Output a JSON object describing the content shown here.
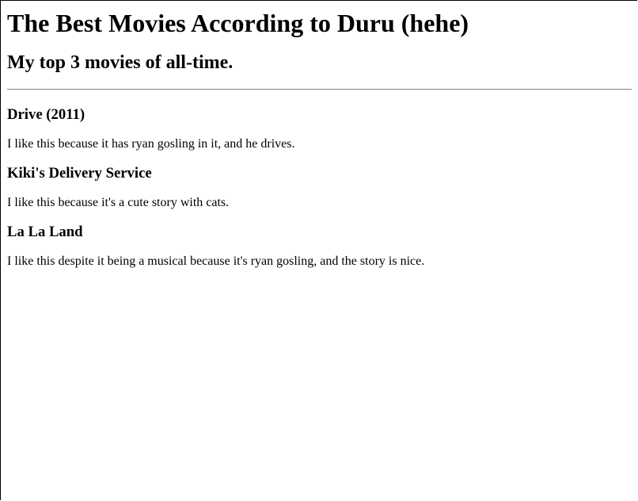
{
  "page": {
    "title": "The Best Movies According to Duru (hehe)",
    "subtitle": "My top 3 movies of all-time."
  },
  "movies": [
    {
      "title": "Drive (2011)",
      "description": "I like this because it has ryan gosling in it, and he drives."
    },
    {
      "title": "Kiki's Delivery Service",
      "description": "I like this because it's a cute story with cats."
    },
    {
      "title": "La La Land",
      "description": "I like this despite it being a musical because it's ryan gosling, and the story is nice."
    }
  ]
}
